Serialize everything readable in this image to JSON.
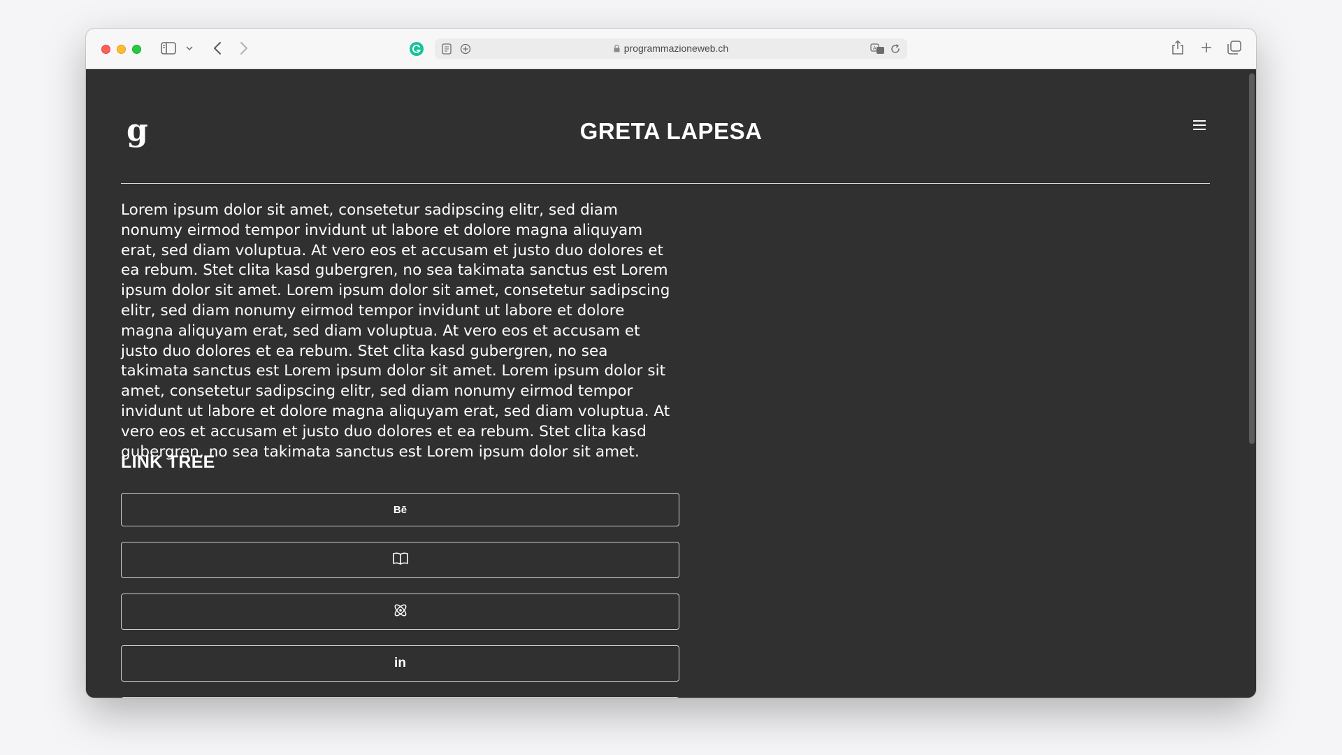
{
  "browser": {
    "url": "programmazioneweb.ch",
    "icons": {
      "sidebar": "sidebar-icon",
      "back": "chevron-left-icon",
      "forward": "chevron-right-icon",
      "extension": "grammarly-icon",
      "reader": "reader-icon",
      "translate": "translate-icon",
      "reload": "reload-icon",
      "share": "share-icon",
      "new_tab": "plus-icon",
      "tabs": "tabs-overview-icon"
    }
  },
  "site": {
    "title": "GRETA LAPESA",
    "logo": "g-monogram-logo",
    "menu_icon": "hamburger-icon",
    "intro": "Lorem ipsum dolor sit amet, consetetur sadipscing elitr, sed diam nonumy eirmod tempor invidunt ut labore et dolore magna aliquyam erat, sed diam voluptua. At vero eos et accusam et justo duo dolores et ea rebum. Stet clita kasd gubergren, no sea takimata sanctus est Lorem ipsum dolor sit amet. Lorem ipsum dolor sit amet, consetetur sadipscing elitr, sed diam nonumy eirmod tempor invidunt ut labore et dolore magna aliquyam erat, sed diam voluptua. At vero eos et accusam et justo duo dolores et ea rebum. Stet clita kasd gubergren, no sea takimata sanctus est Lorem ipsum dolor sit amet. Lorem ipsum dolor sit amet, consetetur sadipscing elitr, sed diam nonumy eirmod tempor invidunt ut labore et dolore magna aliquyam erat, sed diam voluptua. At vero eos et accusam et justo duo dolores et ea rebum. Stet clita kasd gubergren, no sea takimata sanctus est Lorem ipsum dolor sit amet.",
    "link_tree": {
      "heading": "LINK TREE",
      "links": [
        {
          "label": "Bē",
          "icon": "behance-icon"
        },
        {
          "label": "",
          "icon": "book-icon"
        },
        {
          "label": "",
          "icon": "atom-icon"
        },
        {
          "label": "in",
          "icon": "linkedin-icon"
        },
        {
          "label": "",
          "icon": ""
        }
      ]
    }
  },
  "colors": {
    "page_background": "#303030",
    "text": "#ffffff",
    "toolbar": "#f7f7f7"
  }
}
